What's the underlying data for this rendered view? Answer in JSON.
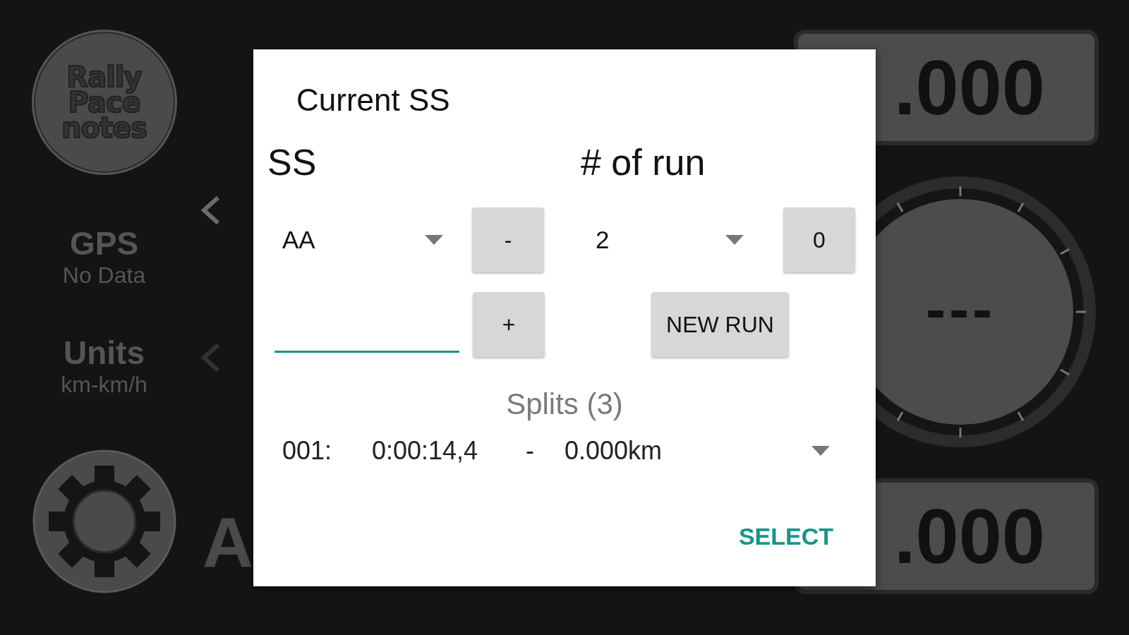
{
  "background": {
    "logo_lines": [
      "Rally",
      "Pace",
      "notes"
    ],
    "chevrons": [
      {
        "enabled": true
      },
      {
        "enabled": false
      }
    ],
    "status": [
      {
        "label": "GPS",
        "value": "No Data"
      },
      {
        "label": "Units",
        "value": "km-km/h"
      }
    ],
    "stage_letter": "A",
    "time_display": ".000",
    "dial_reading": "---",
    "distance_display": ".000"
  },
  "dialog": {
    "title": "Current SS",
    "ss": {
      "label": "SS",
      "value": "AA",
      "minus": "-",
      "plus": "+",
      "name_field": {
        "focused": true
      }
    },
    "run": {
      "label": "# of run",
      "value": "2",
      "reset": "0",
      "new_run": "NEW RUN"
    },
    "splits": {
      "heading": "Splits (3)",
      "selected": {
        "number": "001:",
        "time": "0:00:14,4",
        "separator": "-",
        "distance": "0.000km"
      }
    },
    "action": "SELECT"
  }
}
